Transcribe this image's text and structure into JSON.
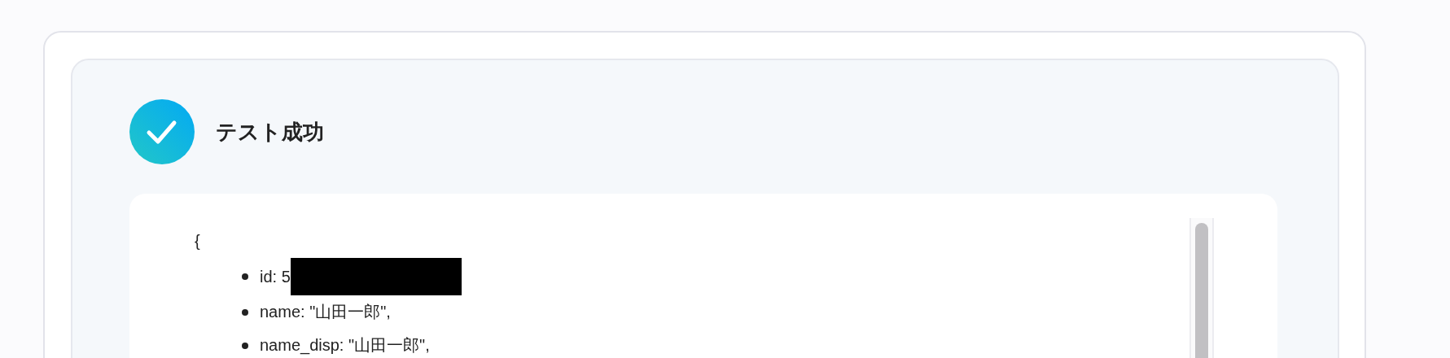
{
  "result": {
    "title": "テスト成功"
  },
  "code": {
    "open_brace": "{",
    "items": [
      {
        "text": "id: 5",
        "redacted": true
      },
      {
        "text": "name: \"山田一郎\",",
        "redacted": false
      },
      {
        "text": "name_disp: \"山田一郎\",",
        "redacted": false
      }
    ]
  }
}
